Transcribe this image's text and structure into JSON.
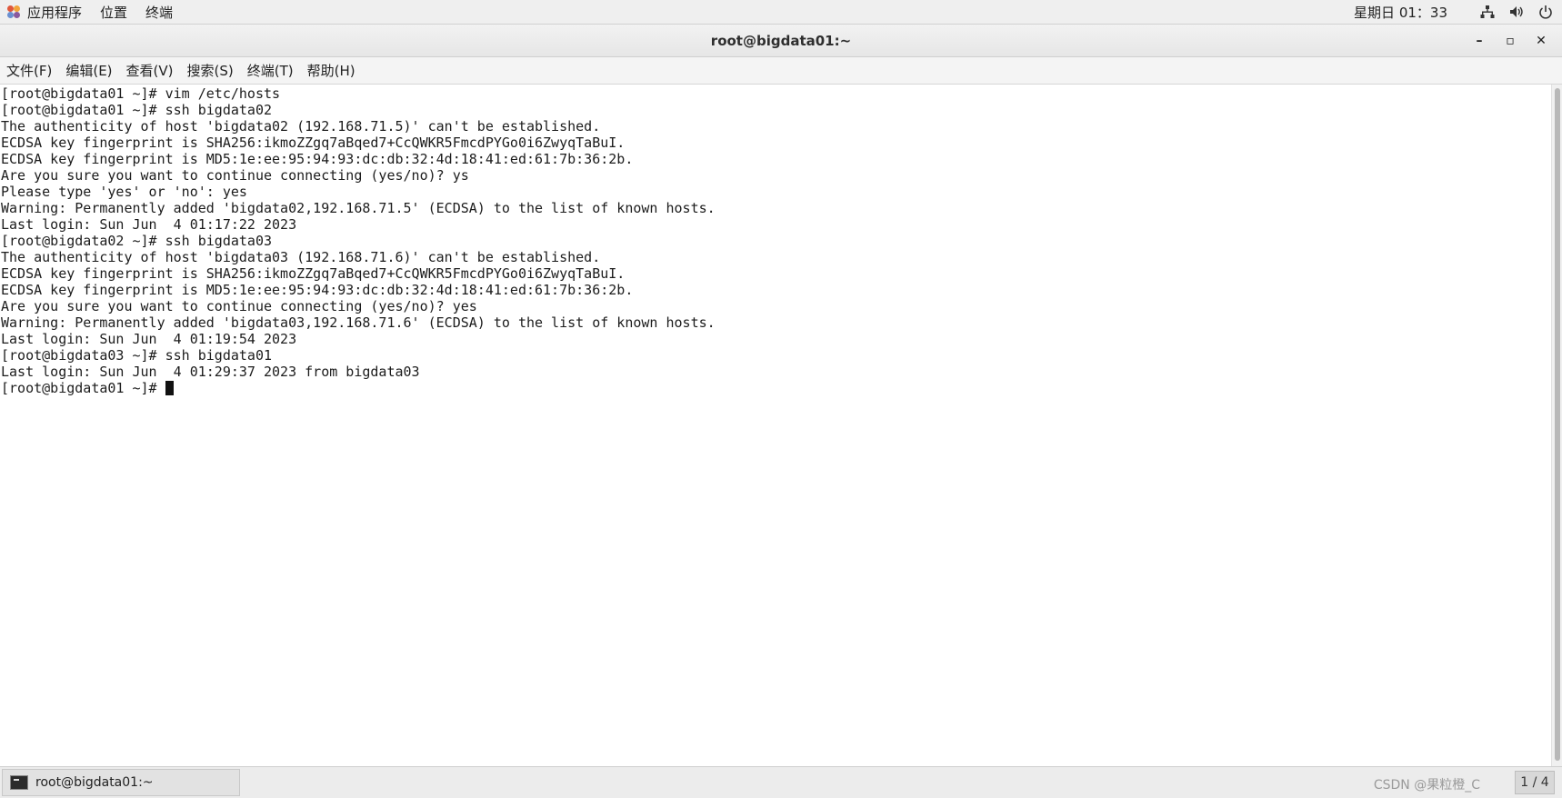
{
  "top_panel": {
    "apps_label": "应用程序",
    "places_label": "位置",
    "terminal_label": "终端",
    "clock": "星期日 01：33"
  },
  "window": {
    "title": "root@bigdata01:~",
    "minimize": "–",
    "maximize": "▫",
    "close": "✕"
  },
  "menubar": {
    "items": [
      "文件(F)",
      "编辑(E)",
      "查看(V)",
      "搜索(S)",
      "终端(T)",
      "帮助(H)"
    ]
  },
  "terminal": {
    "lines": [
      "[root@bigdata01 ~]# vim /etc/hosts",
      "[root@bigdata01 ~]# ssh bigdata02",
      "The authenticity of host 'bigdata02 (192.168.71.5)' can't be established.",
      "ECDSA key fingerprint is SHA256:ikmoZZgq7aBqed7+CcQWKR5FmcdPYGo0i6ZwyqTaBuI.",
      "ECDSA key fingerprint is MD5:1e:ee:95:94:93:dc:db:32:4d:18:41:ed:61:7b:36:2b.",
      "Are you sure you want to continue connecting (yes/no)? ys",
      "Please type 'yes' or 'no': yes",
      "Warning: Permanently added 'bigdata02,192.168.71.5' (ECDSA) to the list of known hosts.",
      "Last login: Sun Jun  4 01:17:22 2023",
      "[root@bigdata02 ~]# ssh bigdata03",
      "The authenticity of host 'bigdata03 (192.168.71.6)' can't be established.",
      "ECDSA key fingerprint is SHA256:ikmoZZgq7aBqed7+CcQWKR5FmcdPYGo0i6ZwyqTaBuI.",
      "ECDSA key fingerprint is MD5:1e:ee:95:94:93:dc:db:32:4d:18:41:ed:61:7b:36:2b.",
      "Are you sure you want to continue connecting (yes/no)? yes",
      "Warning: Permanently added 'bigdata03,192.168.71.6' (ECDSA) to the list of known hosts.",
      "Last login: Sun Jun  4 01:19:54 2023",
      "[root@bigdata03 ~]# ssh bigdata01",
      "Last login: Sun Jun  4 01:29:37 2023 from bigdata03"
    ],
    "prompt": "[root@bigdata01 ~]# "
  },
  "taskbar": {
    "task_label": "root@bigdata01:~",
    "watermark": "CSDN @果粒橙_C",
    "workspace": "1 / 4"
  },
  "icons": {
    "apps": "apps-icon",
    "network": "network-icon",
    "volume": "volume-icon",
    "power": "power-icon",
    "terminal_task": "terminal-icon"
  },
  "colors": {
    "panel_bg": "#efefef",
    "terminal_bg": "#ffffff",
    "terminal_fg": "#1c1c1c"
  }
}
